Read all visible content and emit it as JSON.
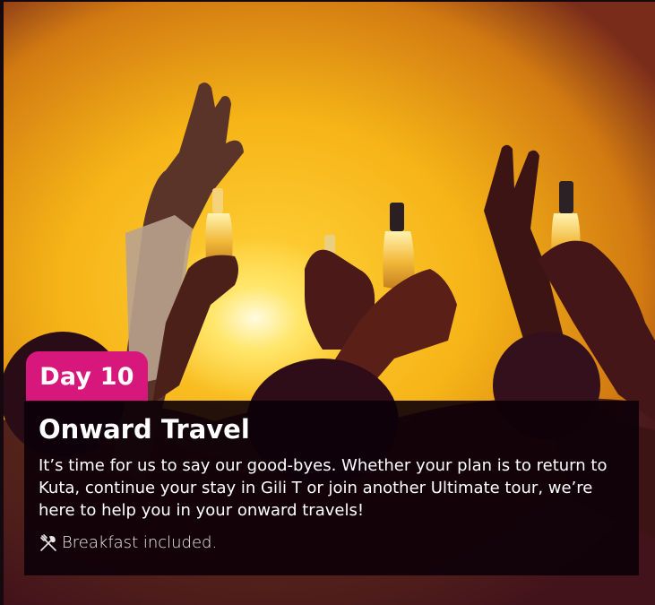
{
  "day_badge": {
    "label": "Day 10",
    "color": "#d8177c"
  },
  "card": {
    "title": "Onward Travel",
    "description": "It’s time for us to say our good-byes. Whether your plan is to return to Kuta, continue your stay in Gili T or join another Ultimate tour, we’re here to help you in your onward travels!",
    "meals": {
      "icon": "cutlery-icon",
      "text": "Breakfast included."
    }
  },
  "photo": {
    "subject": "sunset-party-photo"
  }
}
